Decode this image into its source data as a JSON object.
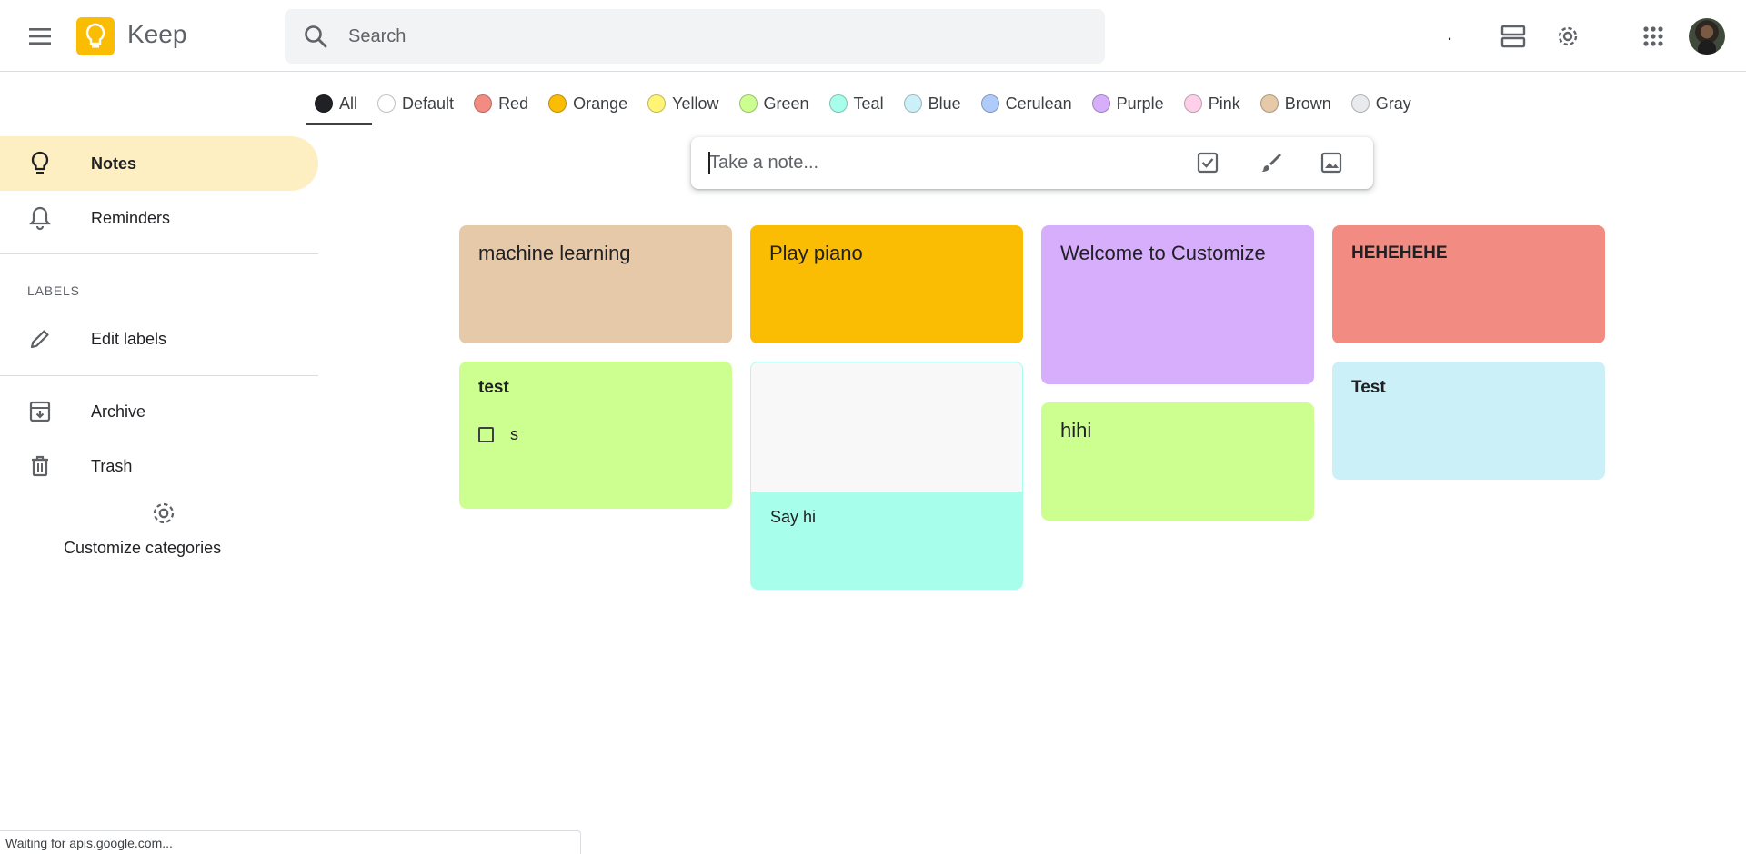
{
  "header": {
    "app_title": "Keep",
    "search_placeholder": "Search",
    "indicator": "."
  },
  "filters": [
    {
      "label": "All",
      "color": "#202124",
      "active": true
    },
    {
      "label": "Default",
      "color": "#ffffff",
      "active": false
    },
    {
      "label": "Red",
      "color": "#f28b82",
      "active": false
    },
    {
      "label": "Orange",
      "color": "#fbbc04",
      "active": false
    },
    {
      "label": "Yellow",
      "color": "#fff475",
      "active": false
    },
    {
      "label": "Green",
      "color": "#ccff90",
      "active": false
    },
    {
      "label": "Teal",
      "color": "#a7ffeb",
      "active": false
    },
    {
      "label": "Blue",
      "color": "#cbf0f8",
      "active": false
    },
    {
      "label": "Cerulean",
      "color": "#aecbfa",
      "active": false
    },
    {
      "label": "Purple",
      "color": "#d7aefb",
      "active": false
    },
    {
      "label": "Pink",
      "color": "#fdcfe8",
      "active": false
    },
    {
      "label": "Brown",
      "color": "#e6c9a8",
      "active": false
    },
    {
      "label": "Gray",
      "color": "#e8eaed",
      "active": false
    }
  ],
  "sidebar": {
    "notes": "Notes",
    "reminders": "Reminders",
    "labels_heading": "LABELS",
    "edit_labels": "Edit labels",
    "archive": "Archive",
    "trash": "Trash",
    "customize": "Customize categories"
  },
  "take_note": {
    "placeholder": "Take a note..."
  },
  "notes": {
    "ml": {
      "title": "machine learning",
      "color": "#e6c9a8"
    },
    "piano": {
      "title": "Play piano",
      "color": "#fbbc04"
    },
    "welcome": {
      "title": "Welcome to Customize",
      "color": "#d7aefb"
    },
    "hehe": {
      "title": "HEHEHEHE",
      "color": "#f28b82"
    },
    "test": {
      "title": "test",
      "color": "#ccff90",
      "checklist": [
        {
          "text": "s",
          "checked": false
        }
      ]
    },
    "sayhi": {
      "body": "Say hi",
      "color": "#a7ffeb"
    },
    "hihi": {
      "title": "hihi",
      "color": "#ccff90"
    },
    "Test": {
      "title": "Test",
      "color": "#cbf0f8"
    }
  },
  "status_bar": "Waiting for apis.google.com..."
}
